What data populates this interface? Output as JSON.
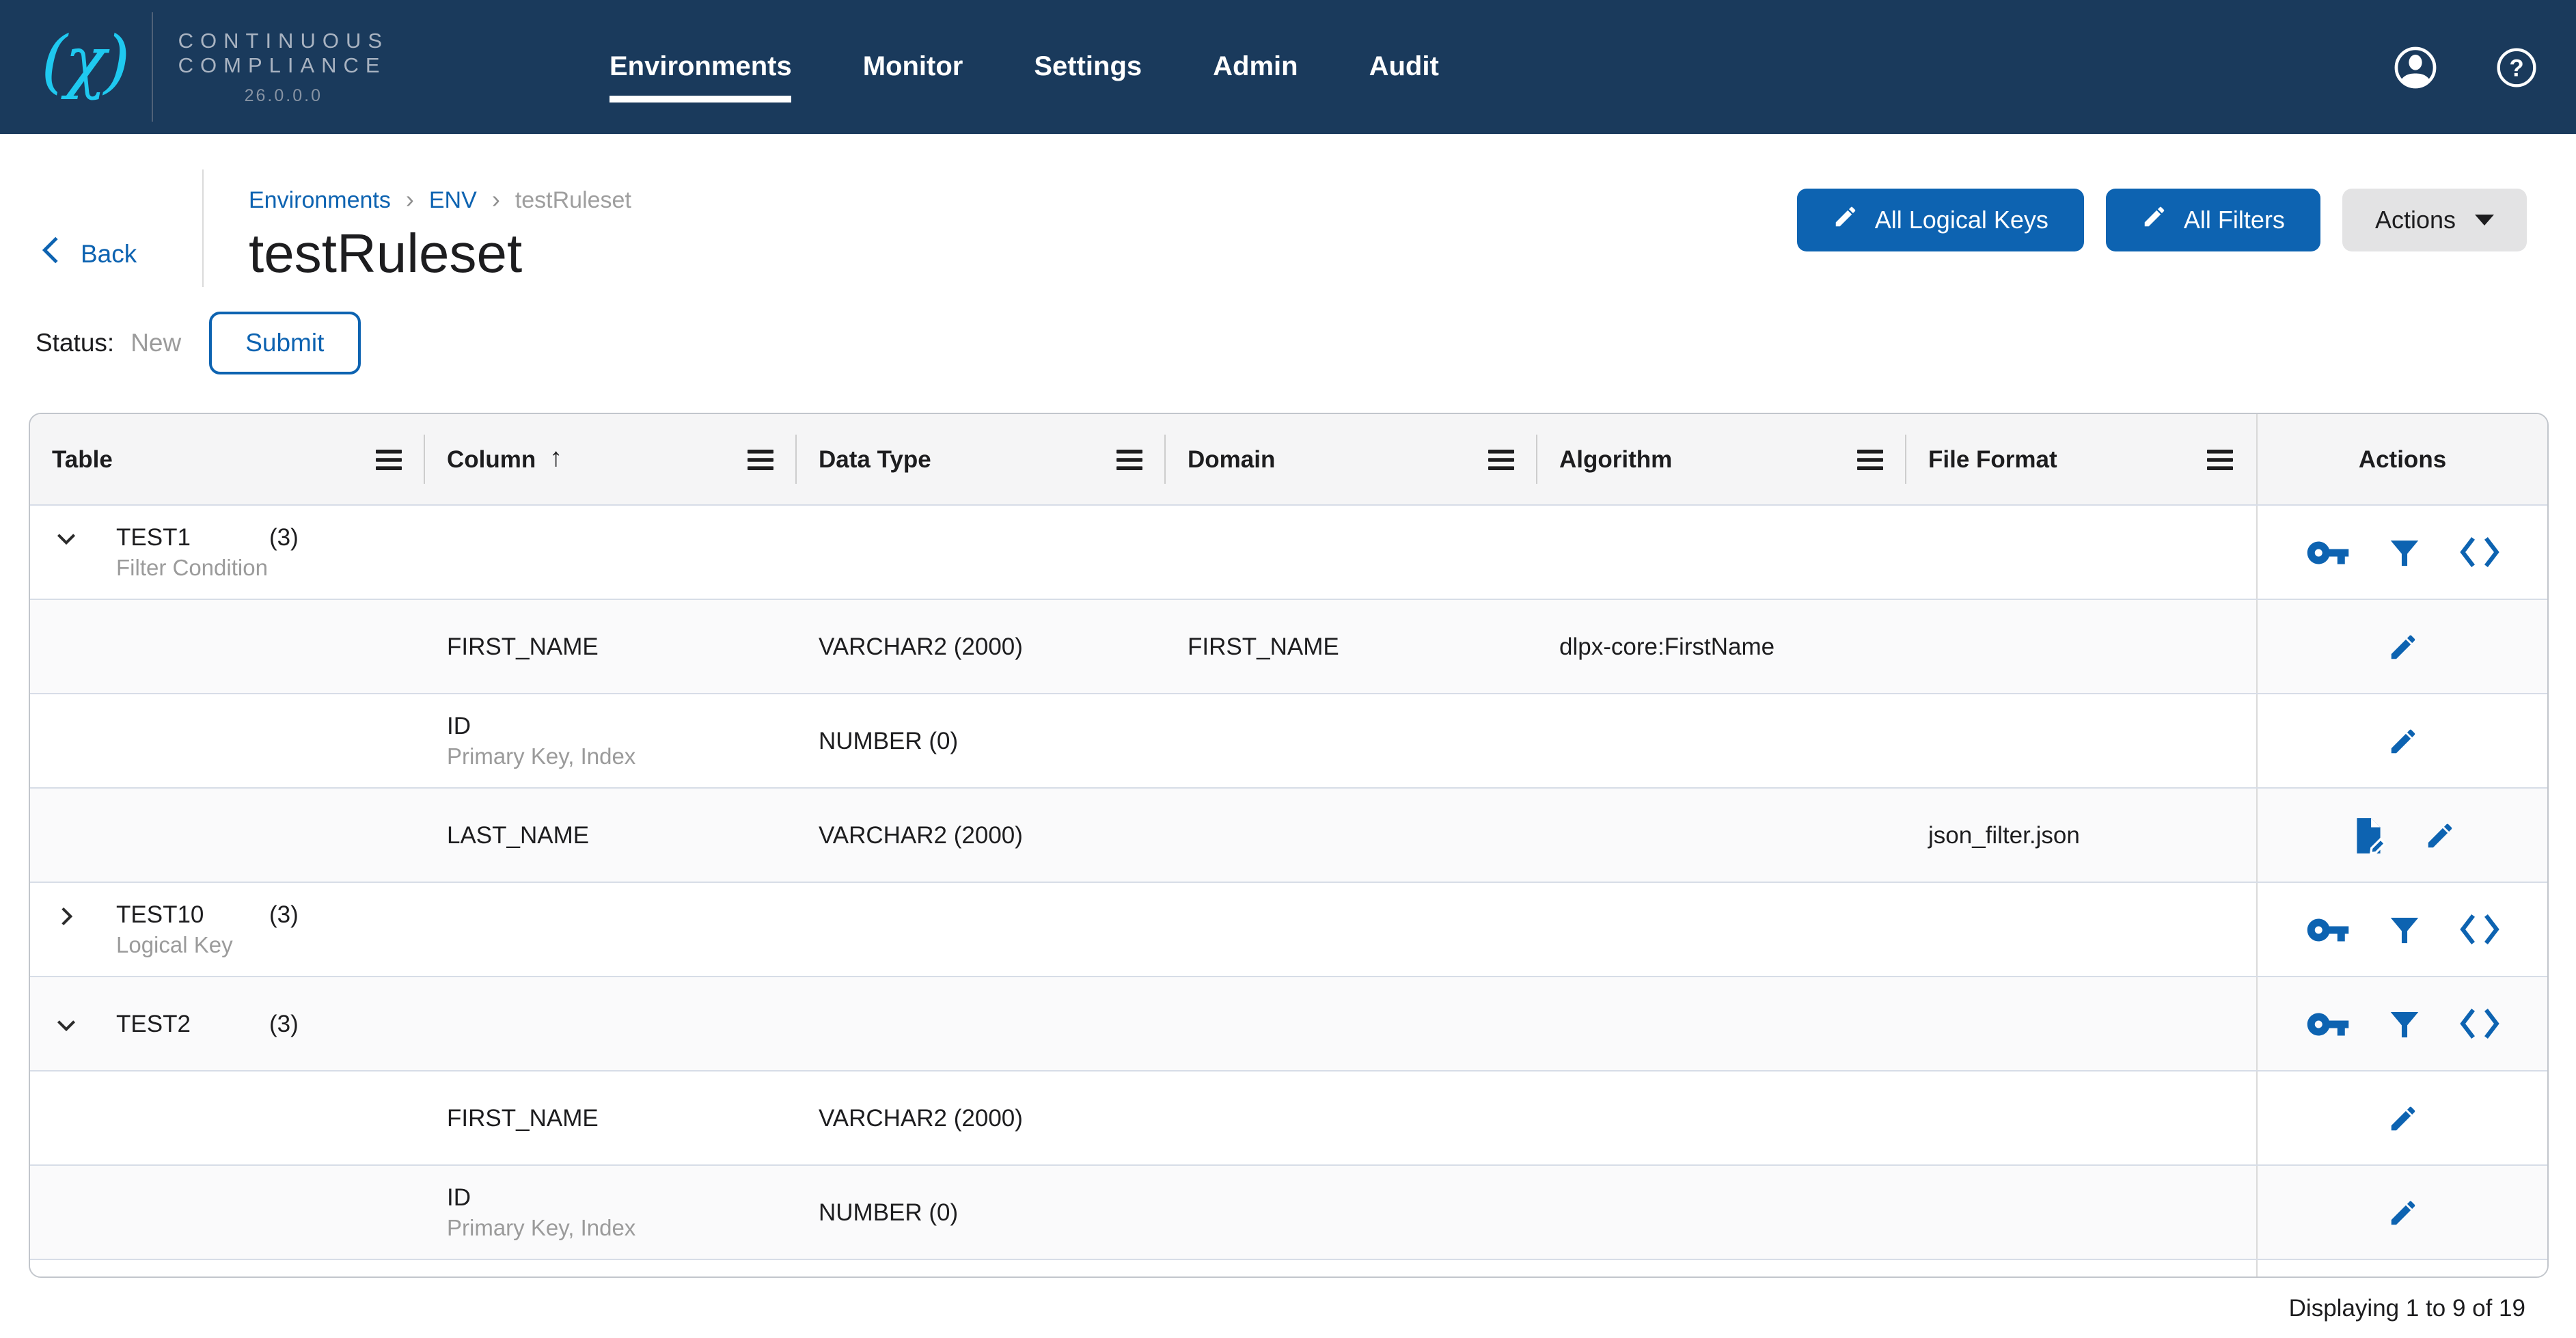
{
  "colors": {
    "navy": "#1A3A5C",
    "accent_blue": "#0D63B1",
    "logo_cyan": "#1FC9F0",
    "row_shade": "#FAFAFB",
    "row_divider": "#D7DDE7"
  },
  "header": {
    "brand": {
      "logo_icon": "delphix-logo",
      "line1": "CONTINUOUS",
      "line2": "COMPLIANCE",
      "version": "26.0.0.0"
    },
    "nav": [
      {
        "label": "Environments",
        "active": true
      },
      {
        "label": "Monitor",
        "active": false
      },
      {
        "label": "Settings",
        "active": false
      },
      {
        "label": "Admin",
        "active": false
      },
      {
        "label": "Audit",
        "active": false
      }
    ],
    "icons": [
      "user-icon",
      "help-icon"
    ]
  },
  "breadcrumb": {
    "separator": "›",
    "items": [
      {
        "label": "Environments",
        "type": "link"
      },
      {
        "label": "ENV",
        "type": "link"
      },
      {
        "label": "testRuleset",
        "type": "current"
      }
    ]
  },
  "page": {
    "back_label": "Back",
    "title": "testRuleset"
  },
  "toolbar": {
    "all_logical_keys": {
      "label": "All Logical Keys",
      "icon": "edit-icon"
    },
    "all_filters": {
      "label": "All Filters",
      "icon": "edit-icon"
    },
    "actions": {
      "label": "Actions",
      "icon": "caret-down-icon"
    }
  },
  "status": {
    "label": "Status:",
    "value": "New",
    "submit": {
      "label": "Submit"
    }
  },
  "table": {
    "columns": [
      {
        "label": "Table",
        "menu_icon": true,
        "sorted": null
      },
      {
        "label": "Column",
        "menu_icon": true,
        "sorted": "asc"
      },
      {
        "label": "Data Type",
        "menu_icon": true,
        "sorted": null
      },
      {
        "label": "Domain",
        "menu_icon": true,
        "sorted": null
      },
      {
        "label": "Algorithm",
        "menu_icon": true,
        "sorted": null
      },
      {
        "label": "File Format",
        "menu_icon": true,
        "sorted": null
      },
      {
        "label": "Actions",
        "menu_icon": false,
        "sorted": null
      }
    ],
    "rows": [
      {
        "type": "group",
        "expanded": true,
        "name": "TEST1",
        "count": "(3)",
        "sublabel": "Filter Condition",
        "actions": [
          "key-icon",
          "filter-icon",
          "code-icon"
        ]
      },
      {
        "type": "column",
        "column": "FIRST_NAME",
        "sublabel": "",
        "data_type": "VARCHAR2 (2000)",
        "domain": "FIRST_NAME",
        "algorithm": "dlpx-core:FirstName",
        "file_format": "",
        "actions": [
          "edit-icon"
        ]
      },
      {
        "type": "column",
        "column": "ID",
        "sublabel": "Primary Key, Index",
        "data_type": "NUMBER (0)",
        "domain": "",
        "algorithm": "",
        "file_format": "",
        "actions": [
          "edit-icon"
        ]
      },
      {
        "type": "column",
        "column": "LAST_NAME",
        "sublabel": "",
        "data_type": "VARCHAR2 (2000)",
        "domain": "",
        "algorithm": "",
        "file_format": "json_filter.json",
        "actions": [
          "file-edit-icon",
          "edit-icon"
        ]
      },
      {
        "type": "group",
        "expanded": false,
        "name": "TEST10",
        "count": "(3)",
        "sublabel": "Logical Key",
        "actions": [
          "key-icon",
          "filter-icon",
          "code-icon"
        ]
      },
      {
        "type": "group",
        "expanded": true,
        "name": "TEST2",
        "count": "(3)",
        "sublabel": "",
        "actions": [
          "key-icon",
          "filter-icon",
          "code-icon"
        ]
      },
      {
        "type": "column",
        "column": "FIRST_NAME",
        "sublabel": "",
        "data_type": "VARCHAR2 (2000)",
        "domain": "",
        "algorithm": "",
        "file_format": "",
        "actions": [
          "edit-icon"
        ]
      },
      {
        "type": "column",
        "column": "ID",
        "sublabel": "Primary Key, Index",
        "data_type": "NUMBER (0)",
        "domain": "",
        "algorithm": "",
        "file_format": "",
        "actions": [
          "edit-icon"
        ]
      },
      {
        "type": "partial"
      }
    ],
    "pagination": "Displaying 1 to 9 of 19"
  }
}
